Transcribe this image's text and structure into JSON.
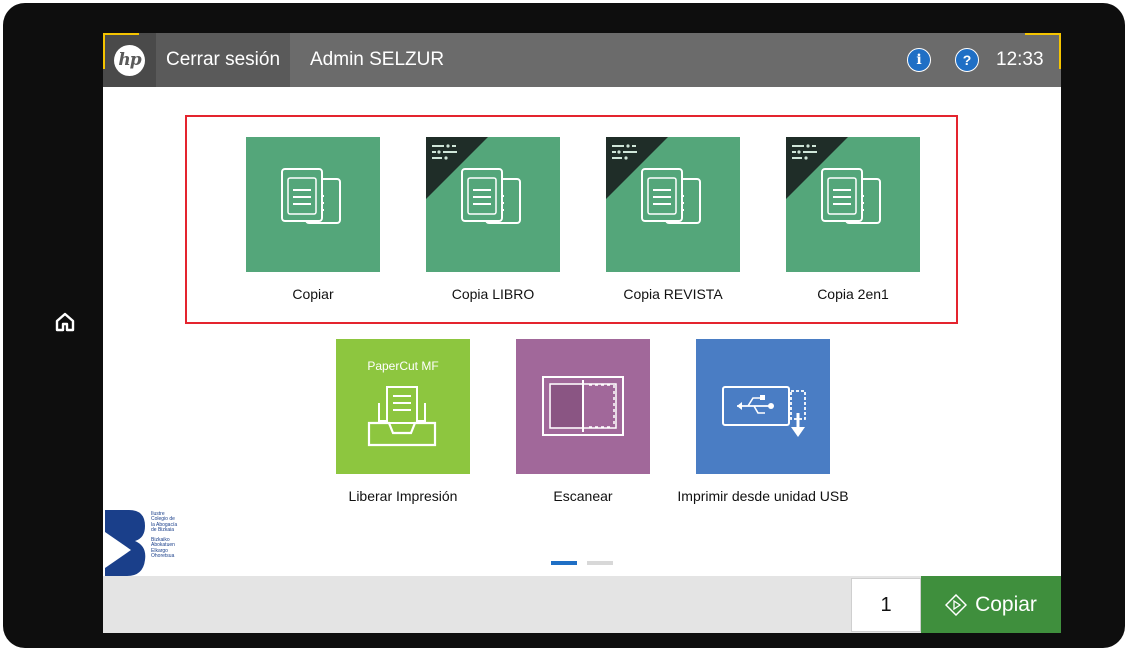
{
  "header": {
    "logo_text": "hp",
    "logout_label": "Cerrar sesión",
    "user_name": "Admin SELZUR",
    "info_icon": "i",
    "help_icon": "?",
    "time": "12:33"
  },
  "apps_row1": [
    {
      "label": "Copiar",
      "icon": "copy-icon",
      "shortcut": false
    },
    {
      "label": "Copia LIBRO",
      "icon": "copy-icon",
      "shortcut": true
    },
    {
      "label": "Copia REVISTA",
      "icon": "copy-icon",
      "shortcut": true
    },
    {
      "label": "Copia 2en1",
      "icon": "copy-icon",
      "shortcut": true
    }
  ],
  "apps_row2": [
    {
      "label": "Liberar Impresión",
      "brand": "PaperCut MF",
      "icon": "release-print-icon",
      "color": "#8dc63f"
    },
    {
      "label": "Escanear",
      "icon": "scan-icon",
      "color": "#a1689a"
    },
    {
      "label": "Imprimir desde unidad USB",
      "icon": "usb-print-icon",
      "color": "#4a7dc4"
    }
  ],
  "logo_caption": [
    "Bizkaiko",
    "Abokatuen",
    "Elkargo",
    "Ohoretsua"
  ],
  "logo_caption_es": [
    "Ilustre",
    "Colegio de",
    "la Abogacía",
    "de Bizkaia"
  ],
  "pager": {
    "pages": 2,
    "current": 1
  },
  "footer": {
    "copies_value": "1",
    "start_label": "Copiar"
  },
  "colors": {
    "topbar": "#6b6b6b",
    "tile_green": "#54a67a",
    "selection_frame": "#e4242e",
    "start_button": "#3f8f3d",
    "accent_yellow": "#f5c400",
    "info_blue": "#1f6fc5"
  }
}
